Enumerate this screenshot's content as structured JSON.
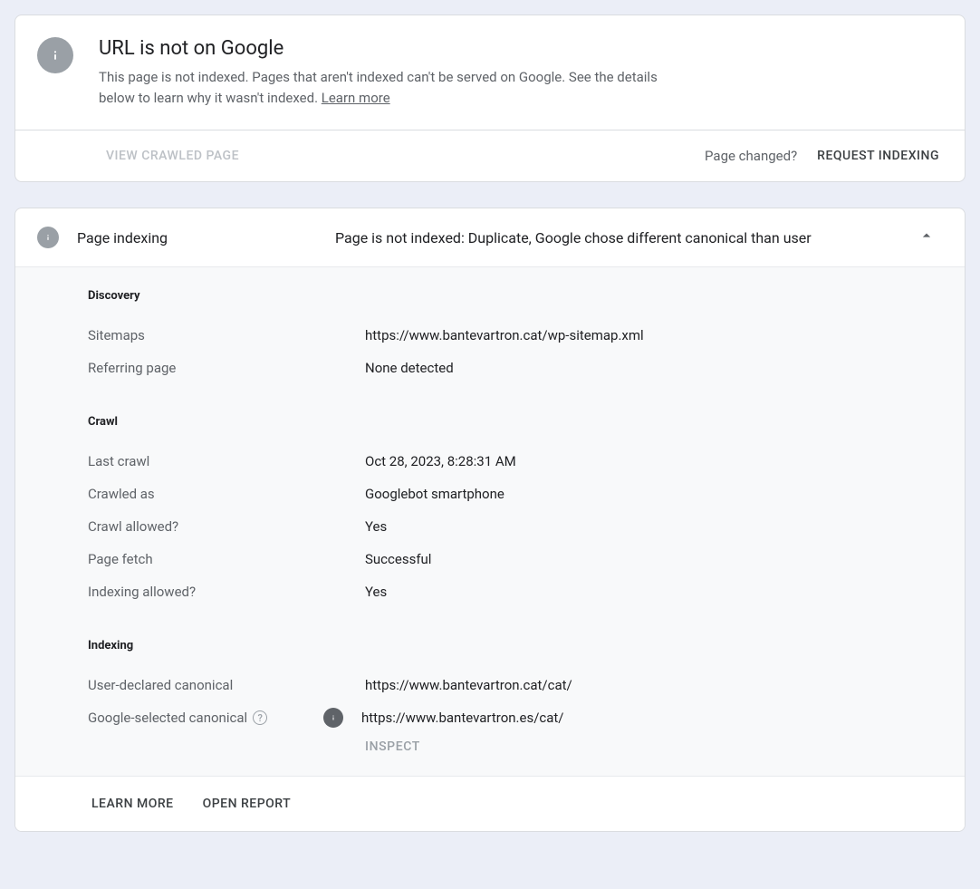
{
  "summary": {
    "title": "URL is not on Google",
    "description_a": "This page is not indexed. Pages that aren't indexed can't be served on Google. See the details below to learn why it wasn't indexed. ",
    "learn_more": "Learn more",
    "view_crawled": "View crawled page",
    "page_changed": "Page changed?",
    "request_indexing": "Request indexing"
  },
  "panel": {
    "label": "Page indexing",
    "status": "Page is not indexed: Duplicate, Google chose different canonical than user"
  },
  "sections": {
    "discovery": {
      "heading": "Discovery",
      "rows": [
        {
          "label": "Sitemaps",
          "value": "https://www.bantevartron.cat/wp-sitemap.xml"
        },
        {
          "label": "Referring page",
          "value": "None detected"
        }
      ]
    },
    "crawl": {
      "heading": "Crawl",
      "rows": [
        {
          "label": "Last crawl",
          "value": "Oct 28, 2023, 8:28:31 AM"
        },
        {
          "label": "Crawled as",
          "value": "Googlebot smartphone"
        },
        {
          "label": "Crawl allowed?",
          "value": "Yes"
        },
        {
          "label": "Page fetch",
          "value": "Successful"
        },
        {
          "label": "Indexing allowed?",
          "value": "Yes"
        }
      ]
    },
    "indexing": {
      "heading": "Indexing",
      "user_canonical_label": "User-declared canonical",
      "user_canonical_value": "https://www.bantevartron.cat/cat/",
      "google_canonical_label": "Google-selected canonical",
      "google_canonical_value": "https://www.bantevartron.es/cat/",
      "inspect": "Inspect"
    }
  },
  "footer": {
    "learn_more": "Learn more",
    "open_report": "Open report"
  }
}
